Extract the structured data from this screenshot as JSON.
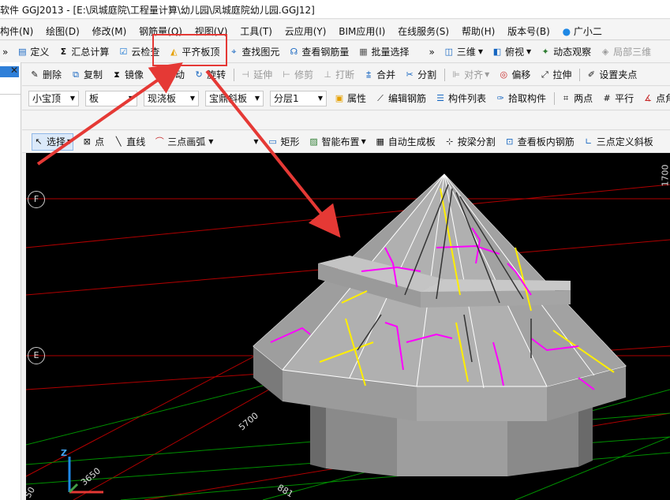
{
  "window": {
    "title": "软件 GGJ2013 - [E:\\凤城庭院\\工程量计算\\幼儿园\\凤城庭院幼儿园.GGJ12]"
  },
  "menu": [
    "构件(N)",
    "绘图(D)",
    "修改(M)",
    "钢筋量(Q)",
    "视图(V)",
    "工具(T)",
    "云应用(Y)",
    "BIM应用(I)",
    "在线服务(S)",
    "帮助(H)",
    "版本号(B)",
    "广小二"
  ],
  "toolbar1": {
    "define": "定义",
    "summary": "汇总计算",
    "cloud_check": "云检查",
    "align_top": "平齐板顶",
    "find": "查找图元",
    "view_rebar": "查看钢筋量",
    "batch_select": "批量选择",
    "view3d": "三维",
    "top_view": "俯视",
    "dynamic": "动态观察",
    "local3d": "局部三维"
  },
  "toolbar2": {
    "delete": "删除",
    "copy": "复制",
    "mirror": "镜像",
    "move": "移动",
    "rotate": "旋转",
    "extend": "延伸",
    "trim": "修剪",
    "break": "打断",
    "merge": "合并",
    "split": "分割",
    "align": "对齐",
    "offset": "偏移",
    "stretch": "拉伸",
    "set_grip": "设置夹点"
  },
  "toolbar3": {
    "component": "小宝顶",
    "type": "板",
    "subtype": "现浇板",
    "name": "宝鼎斜板",
    "layer": "分层1",
    "props": "属性",
    "edit_rebar": "编辑钢筋",
    "list": "构件列表",
    "pick": "拾取构件",
    "two_points": "两点",
    "parallel": "平行",
    "point_angle": "点角"
  },
  "toolbar4": {
    "select": "选择",
    "point": "点",
    "line": "直线",
    "arc": "三点画弧",
    "rect": "矩形",
    "smart": "智能布置",
    "auto_gen": "自动生成板",
    "beam_split": "按梁分割",
    "view_slab_rebar": "查看板内钢筋",
    "three_point_slope": "三点定义斜板"
  },
  "viewport": {
    "axis_f": "F",
    "axis_e": "E",
    "dim_5700": "5700",
    "dim_3650": "3650",
    "dim_881": "881",
    "dim_1700": "1700",
    "dim_50": "50",
    "z_label": "Z"
  },
  "colors": {
    "highlight": "#e53935",
    "rebar_yellow": "#ffee00",
    "rebar_magenta": "#ff00ff",
    "grid_red": "#cc0000",
    "grid_green": "#00aa00"
  }
}
